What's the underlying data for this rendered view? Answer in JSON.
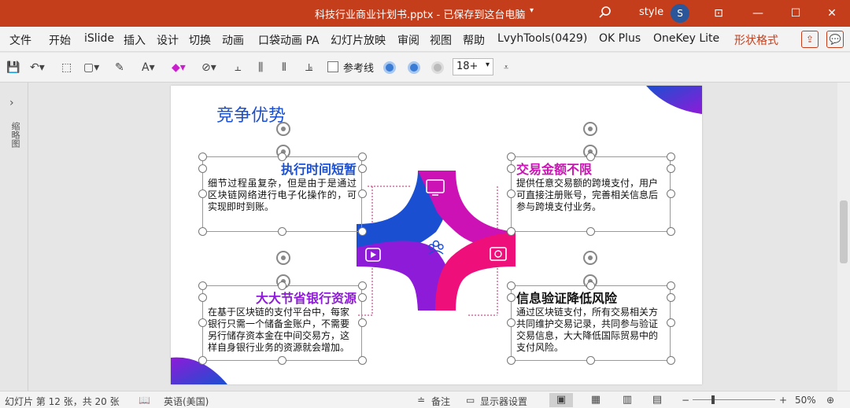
{
  "titlebar": {
    "doc_title": "科技行业商业计划书.pptx - 已保存到这台电脑",
    "user": "style",
    "avatar_initial": "S"
  },
  "menu": {
    "tabs": [
      "文件",
      "开始",
      "iSlide",
      "插入",
      "设计",
      "切换",
      "动画",
      "口袋动画 PA",
      "幻灯片放映",
      "审阅",
      "视图",
      "帮助",
      "LvyhTools(0429)",
      "OK Plus",
      "OneKey Lite",
      "形状格式"
    ]
  },
  "toolbar": {
    "gridlines_label": "参考线",
    "font_size": "18+"
  },
  "thumbpane": {
    "label": "缩略图"
  },
  "slide": {
    "title": "竞争优势",
    "boxes": [
      {
        "heading": "执行时间短暂",
        "body": "细节过程虽复杂，但是由于是通过区块链网络进行电子化操作的，可实现即时到账。"
      },
      {
        "heading": "交易金额不限",
        "body": "提供任意交易额的跨境支付，用户可直接注册账号，完善相关信息后参与跨境支付业务。"
      },
      {
        "heading": "大大节省银行资源",
        "body": "在基于区块链的支付平台中，每家银行只需一个储备金账户，不需要另行储存资本金在中间交易方，这样自身银行业务的资源就会增加。"
      },
      {
        "heading": "信息验证降低风险",
        "body": "通过区块链支付，所有交易相关方共同维护交易记录，共同参与验证交易信息，大大降低国际贸易中的支付风险。"
      }
    ],
    "colors": {
      "blue": "#1a4fd1",
      "magenta": "#cc12b5",
      "purple": "#8e1bd8",
      "pink": "#ee0f7a"
    }
  },
  "statusbar": {
    "slide_info": "幻灯片 第 12 张，共 20 张",
    "language": "英语(美国)",
    "notes": "备注",
    "display_settings": "显示器设置",
    "zoom": "50%"
  }
}
